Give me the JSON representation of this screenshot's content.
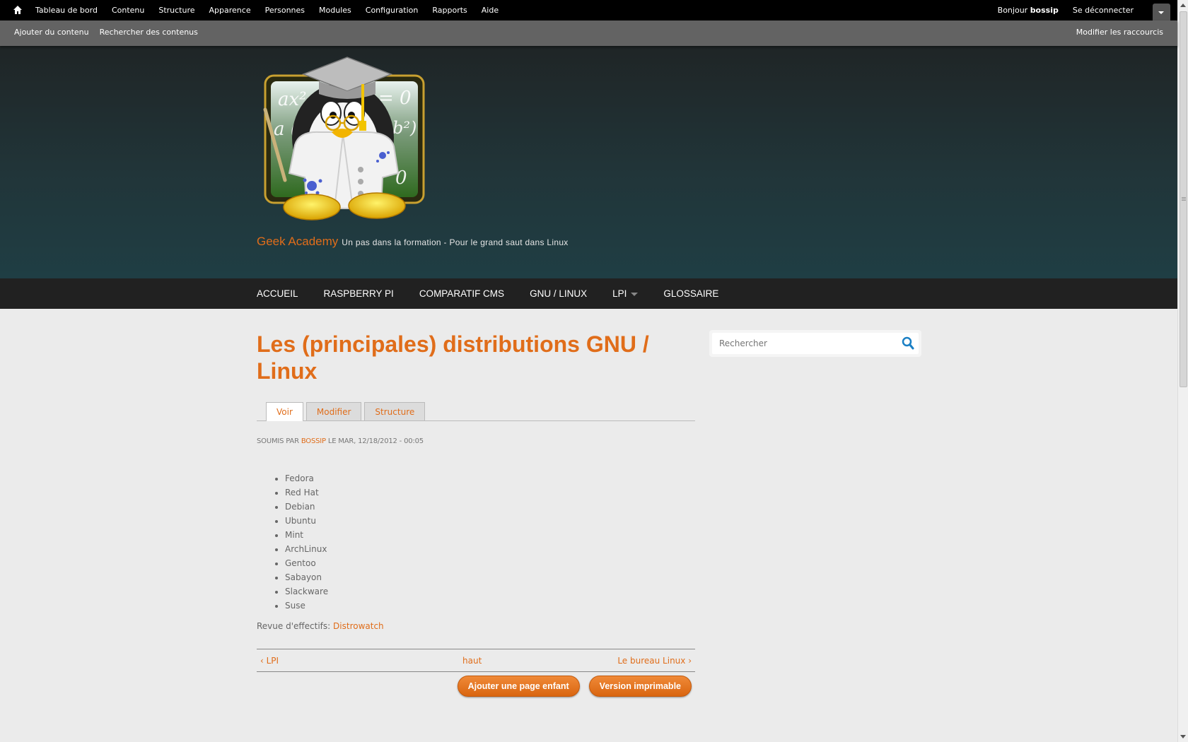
{
  "admin_toolbar": {
    "items": [
      "Tableau de bord",
      "Contenu",
      "Structure",
      "Apparence",
      "Personnes",
      "Modules",
      "Configuration",
      "Rapports",
      "Aide"
    ],
    "greeting": "Bonjour",
    "username": "bossip",
    "logout": "Se déconnecter"
  },
  "shortcuts": {
    "items": [
      "Ajouter du contenu",
      "Rechercher des contenus"
    ],
    "edit": "Modifier les raccourcis"
  },
  "header": {
    "site_name": "Geek Academy",
    "slogan": "Un pas dans la formation - Pour le grand saut dans Linux",
    "logo_text": [
      "ax²",
      "= 0",
      "a (",
      "b²)",
      "0"
    ]
  },
  "main_nav": [
    "ACCUEIL",
    "RASPBERRY PI",
    "COMPARATIF CMS",
    "GNU / LINUX",
    "LPI",
    "GLOSSAIRE"
  ],
  "page": {
    "title": "Les (principales) distributions GNU / Linux",
    "tabs": [
      "Voir",
      "Modifier",
      "Structure"
    ],
    "submitted_prefix": "Soumis par",
    "author": "bossip",
    "submitted_suffix": "le mar, 12/18/2012 - 00:05",
    "distros": [
      "Fedora",
      "Red Hat",
      "Debian",
      "Ubuntu",
      "Mint",
      "ArchLinux",
      "Gentoo",
      "Sabayon",
      "Slackware",
      "Suse"
    ],
    "review_label": "Revue d'effectifs:",
    "review_link": "Distrowatch",
    "book_nav": {
      "prev": "‹ LPI",
      "up": "haut",
      "next": "Le bureau Linux ›"
    },
    "buttons": [
      "Ajouter une page enfant",
      "Version imprimable"
    ]
  },
  "search": {
    "placeholder": "Rechercher"
  },
  "colors": {
    "accent": "#e06d1a",
    "header_bg": "#213539",
    "nav_bg": "#212121"
  }
}
